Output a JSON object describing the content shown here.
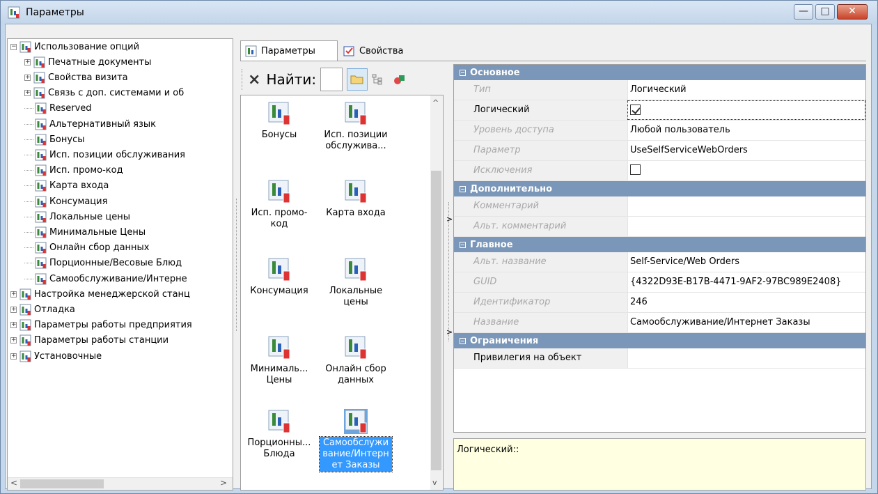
{
  "window": {
    "title": "Параметры",
    "buttons": {
      "minimize": "—",
      "maximize": "□",
      "close": "✕"
    }
  },
  "tree": {
    "items": [
      {
        "label": "Использование опций",
        "expander": "−",
        "level": 0
      },
      {
        "label": "Печатные документы",
        "expander": "+",
        "level": 1
      },
      {
        "label": "Свойства визита",
        "expander": "+",
        "level": 1
      },
      {
        "label": "Связь с доп. системами и об",
        "expander": "+",
        "level": 1
      },
      {
        "label": "Reserved",
        "expander": "",
        "level": 1
      },
      {
        "label": "Альтернативный язык",
        "expander": "",
        "level": 1
      },
      {
        "label": "Бонусы",
        "expander": "",
        "level": 1
      },
      {
        "label": "Исп. позиции обслуживания",
        "expander": "",
        "level": 1
      },
      {
        "label": "Исп. промо-код",
        "expander": "",
        "level": 1
      },
      {
        "label": "Карта входа",
        "expander": "",
        "level": 1
      },
      {
        "label": "Консумация",
        "expander": "",
        "level": 1
      },
      {
        "label": "Локальные цены",
        "expander": "",
        "level": 1
      },
      {
        "label": "Минимальные Цены",
        "expander": "",
        "level": 1
      },
      {
        "label": "Онлайн сбор данных",
        "expander": "",
        "level": 1
      },
      {
        "label": "Порционные/Весовые Блюд",
        "expander": "",
        "level": 1
      },
      {
        "label": "Самообслуживание/Интерне",
        "expander": "",
        "level": 1
      },
      {
        "label": "Настройка менеджерской станц",
        "expander": "+",
        "level": 0
      },
      {
        "label": "Отладка",
        "expander": "+",
        "level": 0
      },
      {
        "label": "Параметры работы предприятия",
        "expander": "+",
        "level": 0
      },
      {
        "label": "Параметры работы станции",
        "expander": "+",
        "level": 0
      },
      {
        "label": "Установочные",
        "expander": "+",
        "level": 0
      }
    ],
    "scroll_left": "<",
    "scroll_right": ">"
  },
  "tabs": [
    {
      "label": "Параметры",
      "active": true
    },
    {
      "label": "Свойства",
      "active": false
    }
  ],
  "toolbar": {
    "clear_label": "×",
    "find_label": "Найти:",
    "find_value": ""
  },
  "icons": [
    {
      "caption": "Бонусы",
      "selected": false
    },
    {
      "caption": "Исп. позиции обслужива...",
      "selected": false
    },
    {
      "caption": "Исп. промо-код",
      "selected": false
    },
    {
      "caption": "Карта входа",
      "selected": false
    },
    {
      "caption": "Консумация",
      "selected": false
    },
    {
      "caption": "Локальные цены",
      "selected": false
    },
    {
      "caption": "Минималь... Цены",
      "selected": false
    },
    {
      "caption": "Онлайн сбор данных",
      "selected": false
    },
    {
      "caption": "Порционны... Блюда",
      "selected": false
    },
    {
      "caption": "Самообслуживание/Интернет Заказы",
      "selected": true
    }
  ],
  "iconlist_scroll": {
    "up": "^",
    "down": "v"
  },
  "splitter": {
    "arrow": ">"
  },
  "properties": {
    "sections": [
      {
        "title": "Основное",
        "rows": [
          {
            "name": "Тип",
            "value": "Логический",
            "disabled": true,
            "type": "text"
          },
          {
            "name": "Логический",
            "value": "",
            "disabled": false,
            "type": "checkbox",
            "checked": true,
            "editing": true
          },
          {
            "name": "Уровень доступа",
            "value": "Любой пользователь",
            "disabled": true,
            "type": "text"
          },
          {
            "name": "Параметр",
            "value": "UseSelfServiceWebOrders",
            "disabled": true,
            "type": "text"
          },
          {
            "name": "Исключения",
            "value": "",
            "disabled": true,
            "type": "checkbox",
            "checked": false
          }
        ]
      },
      {
        "title": "Дополнительно",
        "rows": [
          {
            "name": "Комментарий",
            "value": "",
            "disabled": true,
            "type": "text"
          },
          {
            "name": "Альт. комментарий",
            "value": "",
            "disabled": true,
            "type": "text"
          }
        ]
      },
      {
        "title": "Главное",
        "rows": [
          {
            "name": "Альт. название",
            "value": "Self-Service/Web Orders",
            "disabled": true,
            "type": "text"
          },
          {
            "name": "GUID",
            "value": "{4322D93E-B17B-4471-9AF2-97BC989E2408}",
            "disabled": true,
            "type": "text"
          },
          {
            "name": "Идентификатор",
            "value": "246",
            "disabled": true,
            "type": "text"
          },
          {
            "name": "Название",
            "value": "Самообслуживание/Интернет Заказы",
            "disabled": true,
            "type": "text"
          }
        ]
      },
      {
        "title": "Ограничения",
        "rows": [
          {
            "name": "Привилегия на объект",
            "value": "",
            "disabled": false,
            "type": "text"
          }
        ]
      }
    ]
  },
  "help": {
    "text": "Логический::"
  },
  "colors": {
    "category_bg": "#7a96b8",
    "selection": "#3399ff",
    "help_bg": "#ffffe1"
  }
}
